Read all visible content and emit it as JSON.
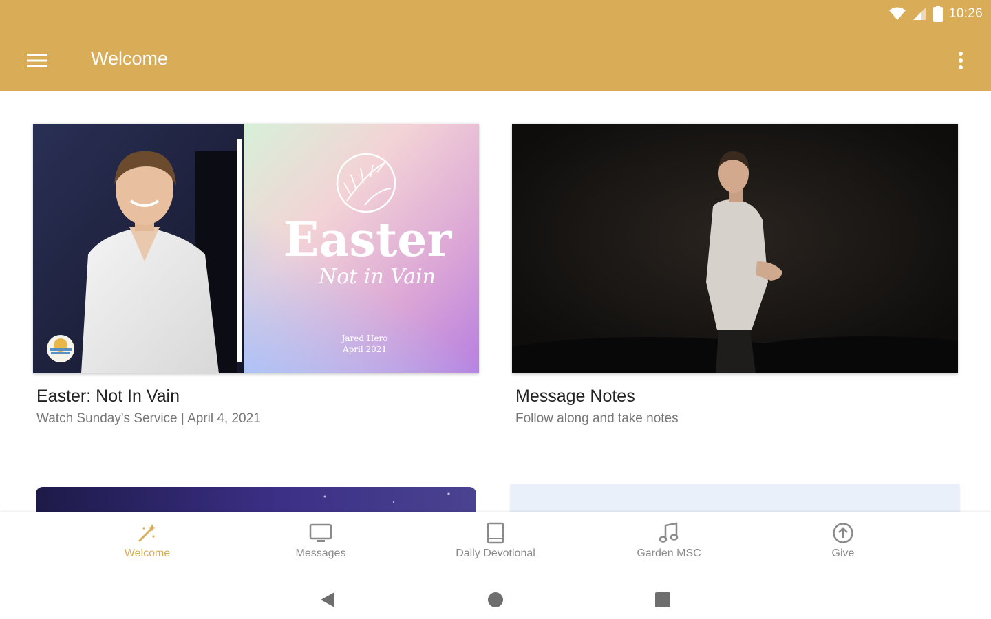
{
  "status_bar": {
    "time": "10:26"
  },
  "toolbar": {
    "title": "Welcome"
  },
  "cards": [
    {
      "title": "Easter: Not In Vain",
      "subtitle": "Watch Sunday's Service | April 4, 2021",
      "graphic": {
        "headline": "Easter",
        "script": "Not in Vain",
        "line1": "Jared Hero",
        "line2": "April 2021"
      }
    },
    {
      "title": "Message Notes",
      "subtitle": "Follow along and take notes"
    }
  ],
  "bottom_nav": {
    "items": [
      {
        "label": "Welcome",
        "icon": "wand-icon",
        "active": true
      },
      {
        "label": "Messages",
        "icon": "tv-icon"
      },
      {
        "label": "Daily Devotional",
        "icon": "book-icon"
      },
      {
        "label": "Garden MSC",
        "icon": "music-note-icon"
      },
      {
        "label": "Give",
        "icon": "arrow-up-circle-icon"
      }
    ]
  },
  "colors": {
    "accent": "#d9ac58",
    "inactive": "#8a8a8a"
  }
}
